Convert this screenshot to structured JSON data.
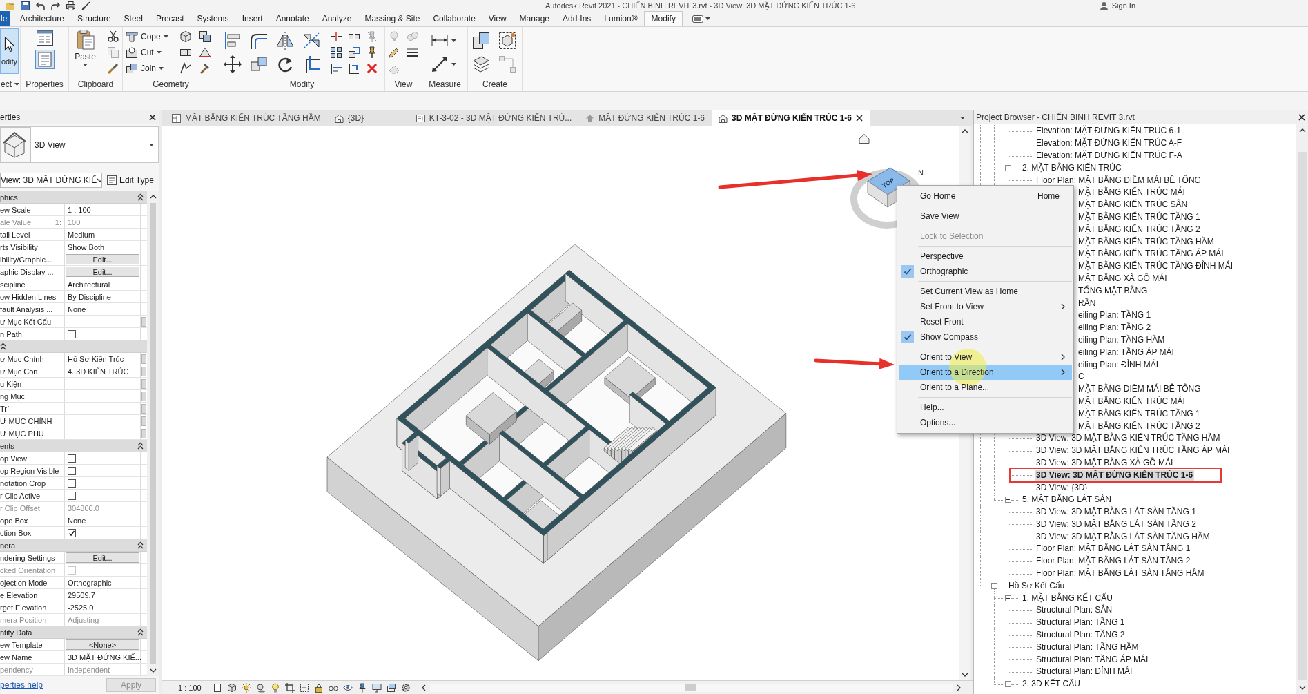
{
  "title_bar": {
    "title": "Autodesk Revit 2021 - CHIẾN BINH REVIT 3.rvt - 3D View: 3D MẶT ĐỨNG KIẾN TRÚC 1-6",
    "sign_in": "Sign In"
  },
  "ribbon": {
    "tabs": [
      {
        "label": "le",
        "kind": "app",
        "selected": false
      },
      {
        "label": "Architecture",
        "kind": "tab",
        "selected": false
      },
      {
        "label": "Structure",
        "kind": "tab",
        "selected": false
      },
      {
        "label": "Steel",
        "kind": "tab",
        "selected": false
      },
      {
        "label": "Precast",
        "kind": "tab",
        "selected": false
      },
      {
        "label": "Systems",
        "kind": "tab",
        "selected": false
      },
      {
        "label": "Insert",
        "kind": "tab",
        "selected": false
      },
      {
        "label": "Annotate",
        "kind": "tab",
        "selected": false
      },
      {
        "label": "Analyze",
        "kind": "tab",
        "selected": false
      },
      {
        "label": "Massing & Site",
        "kind": "tab",
        "selected": false
      },
      {
        "label": "Collaborate",
        "kind": "tab",
        "selected": false
      },
      {
        "label": "View",
        "kind": "tab",
        "selected": false
      },
      {
        "label": "Manage",
        "kind": "tab",
        "selected": false
      },
      {
        "label": "Add-Ins",
        "kind": "tab",
        "selected": false
      },
      {
        "label": "Lumion®",
        "kind": "tab",
        "selected": false
      },
      {
        "label": "Modify",
        "kind": "tab",
        "selected": true
      }
    ],
    "panels": [
      {
        "kind": "select",
        "label": "ect",
        "tools": [
          {
            "label": "odify",
            "selected": true
          }
        ]
      },
      {
        "kind": "properties",
        "label": "Properties"
      },
      {
        "kind": "clipboard",
        "label": "Clipboard",
        "tools": [
          {
            "label": "Paste"
          }
        ]
      },
      {
        "kind": "geometry",
        "label": "Geometry",
        "tools": [
          {
            "label": "Cope"
          },
          {
            "label": "Cut"
          },
          {
            "label": "Join"
          }
        ]
      },
      {
        "kind": "modify",
        "label": "Modify"
      },
      {
        "kind": "view",
        "label": "View"
      },
      {
        "kind": "measure",
        "label": "Measure"
      },
      {
        "kind": "create",
        "label": "Create"
      }
    ]
  },
  "properties": {
    "title": "erties",
    "type_name": "3D View",
    "view_selector": "View: 3D MẶT ĐỨNG KIẾ",
    "edit_type": "Edit Type",
    "groups": [
      {
        "label": "phics",
        "rows": [
          {
            "label": "ew Scale",
            "value": "1 : 100",
            "kind": "text",
            "disabled": false,
            "side_button": false
          },
          {
            "label": "ale Value",
            "unit": "1:",
            "value": "100",
            "kind": "text",
            "disabled": true,
            "side_button": false
          },
          {
            "label": "tail Level",
            "value": "Medium",
            "kind": "text",
            "disabled": false,
            "side_button": false
          },
          {
            "label": "rts Visibility",
            "value": "Show Both",
            "kind": "text",
            "disabled": false,
            "side_button": false
          },
          {
            "label": "ibility/Graphic...",
            "value": "Edit...",
            "kind": "button",
            "disabled": false,
            "side_button": false
          },
          {
            "label": "aphic Display ...",
            "value": "Edit...",
            "kind": "button",
            "disabled": false,
            "side_button": false
          },
          {
            "label": "scipline",
            "value": "Architectural",
            "kind": "text",
            "disabled": false,
            "side_button": false
          },
          {
            "label": "ow Hidden Lines",
            "value": "By Discipline",
            "kind": "text",
            "disabled": false,
            "side_button": false
          },
          {
            "label": "fault Analysis ...",
            "value": "None",
            "kind": "text",
            "disabled": false,
            "side_button": false
          },
          {
            "label": "ư Mục Kết Cấu",
            "kind": "text",
            "disabled": false,
            "side_button": true
          },
          {
            "label": "n Path",
            "kind": "checkbox",
            "checked": false,
            "disabled": false,
            "side_button": false
          }
        ]
      },
      {
        "rows": [
          {
            "label": "ư Mục Chính",
            "value": "Hồ Sơ Kiến Trúc",
            "kind": "text",
            "disabled": false,
            "side_button": true
          },
          {
            "label": "ư Mục Con",
            "value": "4. 3D KIẾN TRÚC",
            "kind": "text",
            "disabled": false,
            "side_button": true
          },
          {
            "label": "u Kiện",
            "kind": "text",
            "disabled": false,
            "side_button": true
          },
          {
            "label": "ng Mục",
            "kind": "text",
            "disabled": false,
            "side_button": true
          },
          {
            "label": "Trí",
            "kind": "text",
            "disabled": false,
            "side_button": true
          },
          {
            "label": "Ư MỤC CHÍNH",
            "kind": "text",
            "disabled": false,
            "side_button": true
          },
          {
            "label": "Ư MỤC PHỤ",
            "kind": "text",
            "disabled": false,
            "side_button": true
          }
        ]
      },
      {
        "label": "ents",
        "rows": [
          {
            "label": "op View",
            "kind": "checkbox",
            "checked": false,
            "disabled": false,
            "side_button": false
          },
          {
            "label": "op Region Visible",
            "kind": "checkbox",
            "checked": false,
            "disabled": false,
            "side_button": false
          },
          {
            "label": "notation Crop",
            "kind": "checkbox",
            "checked": false,
            "disabled": false,
            "side_button": false
          },
          {
            "label": "r Clip Active",
            "kind": "checkbox",
            "checked": false,
            "disabled": false,
            "side_button": false
          },
          {
            "label": "r Clip Offset",
            "value": "304800.0",
            "kind": "text",
            "disabled": true,
            "side_button": false
          },
          {
            "label": "ope Box",
            "value": "None",
            "kind": "text",
            "disabled": false,
            "side_button": false
          },
          {
            "label": "ction Box",
            "kind": "checkbox",
            "checked": true,
            "disabled": false,
            "side_button": false
          }
        ]
      },
      {
        "label": "nera",
        "rows": [
          {
            "label": "ndering Settings",
            "value": "Edit...",
            "kind": "button",
            "disabled": false,
            "side_button": false
          },
          {
            "label": "cked Orientation",
            "kind": "checkbox",
            "checked": false,
            "disabled": true,
            "side_button": false
          },
          {
            "label": "ojection Mode",
            "value": "Orthographic",
            "kind": "text",
            "disabled": false,
            "side_button": false
          },
          {
            "label": "e Elevation",
            "value": "29509.7",
            "kind": "text",
            "disabled": false,
            "side_button": false
          },
          {
            "label": "rget Elevation",
            "value": "-2525.0",
            "kind": "text",
            "disabled": false,
            "side_button": false
          },
          {
            "label": "mera Position",
            "value": "Adjusting",
            "kind": "text",
            "disabled": true,
            "side_button": false
          }
        ]
      },
      {
        "label": "ntity Data",
        "rows": [
          {
            "label": "ew Template",
            "value": "<None>",
            "kind": "button",
            "disabled": false,
            "side_button": false
          },
          {
            "label": "ew Name",
            "value": "3D MẶT ĐỨNG KIẾ...",
            "kind": "text",
            "disabled": false,
            "side_button": false
          },
          {
            "label": "pendency",
            "value": "Independent",
            "kind": "text",
            "disabled": true,
            "side_button": false
          }
        ]
      }
    ],
    "help_link": "perties help",
    "apply": {
      "label": "Apply",
      "disabled": true
    }
  },
  "view_tabs": [
    {
      "label": "MẶT BẰNG KIẾN TRÚC TẦNG HẦM",
      "kind": "plan",
      "selected": false
    },
    {
      "label": "{3D}",
      "kind": "model",
      "selected": false
    },
    {
      "label": "KT-3-02 - 3D MẶT ĐỨNG KIẾN TRÚ...",
      "kind": "sheet",
      "selected": false
    },
    {
      "label": "MẶT ĐỨNG KIẾN TRÚC 1-6",
      "kind": "elevation",
      "selected": false
    },
    {
      "label": "3D MẶT ĐỨNG KIẾN TRÚC 1-6",
      "kind": "model",
      "selected": true
    }
  ],
  "viewport": {
    "view_cube": {
      "face": "TOP",
      "north": "N"
    },
    "scale": "1 : 100"
  },
  "context_menu": {
    "items": [
      {
        "kind": "item",
        "label": "Go Home",
        "shortcut": "Home",
        "checked": false,
        "disabled": false,
        "submenu": false,
        "selected": false
      },
      {
        "kind": "separator"
      },
      {
        "kind": "item",
        "label": "Save View",
        "checked": false,
        "disabled": false,
        "submenu": false,
        "selected": false
      },
      {
        "kind": "separator"
      },
      {
        "kind": "item",
        "label": "Lock to Selection",
        "checked": false,
        "disabled": true,
        "submenu": false,
        "selected": false
      },
      {
        "kind": "separator"
      },
      {
        "kind": "item",
        "label": "Perspective",
        "checked": false,
        "disabled": false,
        "submenu": false,
        "selected": false
      },
      {
        "kind": "item",
        "label": "Orthographic",
        "checked": true,
        "disabled": false,
        "submenu": false,
        "selected": false
      },
      {
        "kind": "separator"
      },
      {
        "kind": "item",
        "label": "Set Current View as Home",
        "checked": false,
        "disabled": false,
        "submenu": false,
        "selected": false
      },
      {
        "kind": "item",
        "label": "Set Front to View",
        "checked": false,
        "disabled": false,
        "submenu": true,
        "selected": false
      },
      {
        "kind": "item",
        "label": "Reset Front",
        "checked": false,
        "disabled": false,
        "submenu": false,
        "selected": false
      },
      {
        "kind": "item",
        "label": "Show Compass",
        "checked": true,
        "disabled": false,
        "submenu": false,
        "selected": false
      },
      {
        "kind": "separator"
      },
      {
        "kind": "item",
        "label": "Orient to View",
        "checked": false,
        "disabled": false,
        "submenu": true,
        "selected": false
      },
      {
        "kind": "item",
        "label": "Orient to a Direction",
        "checked": false,
        "disabled": false,
        "submenu": true,
        "selected": true
      },
      {
        "kind": "item",
        "label": "Orient to a Plane...",
        "checked": false,
        "disabled": false,
        "submenu": false,
        "selected": false
      },
      {
        "kind": "separator"
      },
      {
        "kind": "item",
        "label": "Help...",
        "checked": false,
        "disabled": false,
        "submenu": false,
        "selected": false
      },
      {
        "kind": "item",
        "label": "Options...",
        "checked": false,
        "disabled": false,
        "submenu": false,
        "selected": false
      }
    ]
  },
  "project_browser": {
    "title": "Project Browser - CHIẾN BINH REVIT 3.rvt",
    "tree": [
      {
        "children": [
          {
            "children": [
              {
                "children": [
                  {
                    "label": "Elevation: MẶT ĐỨNG KIẾN TRÚC 6-1",
                    "selected": false
                  },
                  {
                    "label": "Elevation: MẶT ĐỨNG KIẾN TRÚC A-F",
                    "selected": false
                  },
                  {
                    "label": "Elevation: MẶT ĐỨNG KIẾN TRÚC F-A",
                    "selected": false
                  }
                ]
              },
              {
                "label": "2. MẶT BẰNG KIẾN TRÚC",
                "expanded": true,
                "selected": false,
                "children": [
                  {
                    "label": "Floor Plan: MẶT BẰNG DIỀM MÁI BÊ TÔNG",
                    "selected": false
                  },
                  {
                    "label": "MẶT BẰNG KIẾN TRÚC MÁI",
                    "selected": false
                  },
                  {
                    "label": "MẶT BẰNG KIẾN TRÚC SÂN",
                    "selected": false
                  },
                  {
                    "label": "MẶT BẰNG KIẾN TRÚC TẦNG 1",
                    "selected": false
                  },
                  {
                    "label": "MẶT BẰNG KIẾN TRÚC TẦNG 2",
                    "selected": false
                  },
                  {
                    "label": "MẶT BẰNG KIẾN TRÚC TẦNG HẦM",
                    "selected": false
                  },
                  {
                    "label": "MẶT BẰNG KIẾN TRÚC TẦNG ÁP MÁI",
                    "selected": false
                  },
                  {
                    "label": "MẶT BẰNG KIẾN TRÚC TẦNG ĐỈNH MÁI",
                    "selected": false
                  },
                  {
                    "label": "MẶT BẰNG XÀ GỒ MÁI",
                    "selected": false
                  },
                  {
                    "label": "TỔNG MẶT BẰNG",
                    "selected": false
                  }
                ]
              },
              {
                "label": "RẦN",
                "selected": false,
                "children": [
                  {
                    "label": "eiling Plan: TẦNG 1",
                    "selected": false
                  },
                  {
                    "label": "eiling Plan: TẦNG 2",
                    "selected": false
                  },
                  {
                    "label": "eiling Plan: TẦNG HẦM",
                    "selected": false
                  },
                  {
                    "label": "eiling Plan: TẦNG ÁP MÁI",
                    "selected": false
                  },
                  {
                    "label": "eiling Plan: ĐỈNH MÁI",
                    "selected": false
                  }
                ]
              },
              {
                "label": "C",
                "selected": false,
                "children": [
                  {
                    "label": "MẶT BẰNG DIỀM MÁI BÊ TÔNG",
                    "selected": false
                  },
                  {
                    "label": "MẶT BẰNG KIẾN TRÚC MÁI",
                    "selected": false
                  },
                  {
                    "label": "MẶT BẰNG KIẾN TRÚC TẦNG 1",
                    "selected": false
                  },
                  {
                    "label": "MẶT BẰNG KIẾN TRÚC TẦNG 2",
                    "selected": false
                  },
                  {
                    "label": "3D View: 3D MẶT BẰNG KIẾN TRÚC TẦNG HẦM",
                    "selected": false
                  },
                  {
                    "label": "3D View: 3D MẶT BẰNG KIẾN TRÚC TẦNG ÁP MÁI",
                    "selected": false
                  },
                  {
                    "label": "3D View: 3D MẶT BẰNG XÀ GỒ MÁI",
                    "selected": false
                  },
                  {
                    "label": "3D View: 3D MẶT ĐỨNG KIẾN TRÚC 1-6",
                    "selected": true
                  },
                  {
                    "label": "3D View: {3D}",
                    "selected": false
                  }
                ]
              },
              {
                "label": "5. MẶT BẰNG LÁT SÀN",
                "expanded": true,
                "selected": false,
                "children": [
                  {
                    "label": "3D View: 3D MẶT BẰNG LÁT SÀN TẦNG 1",
                    "selected": false
                  },
                  {
                    "label": "3D View: 3D MẶT BẰNG LÁT SÀN TẦNG 2",
                    "selected": false
                  },
                  {
                    "label": "3D View: 3D MẶT BẰNG LÁT SÀN TẦNG HẦM",
                    "selected": false
                  },
                  {
                    "label": "Floor Plan: MẶT BẰNG LÁT SÀN TẦNG 1",
                    "selected": false
                  },
                  {
                    "label": "Floor Plan: MẶT BẰNG LÁT SÀN TẦNG 2",
                    "selected": false
                  },
                  {
                    "label": "Floor Plan: MẶT BẰNG LÁT SÀN TẦNG HẦM",
                    "selected": false
                  }
                ]
              }
            ]
          },
          {
            "label": "Hồ Sơ Kết Cấu",
            "expanded": true,
            "selected": false,
            "children": [
              {
                "label": "1. MẶT BẰNG KẾT CẤU",
                "expanded": true,
                "selected": false,
                "children": [
                  {
                    "label": "Structural Plan: SÂN",
                    "selected": false
                  },
                  {
                    "label": "Structural Plan: TẦNG 1",
                    "selected": false
                  },
                  {
                    "label": "Structural Plan: TẦNG 2",
                    "selected": false
                  },
                  {
                    "label": "Structural Plan: TẦNG HẦM",
                    "selected": false
                  },
                  {
                    "label": "Structural Plan: TẦNG ÁP MÁI",
                    "selected": false
                  },
                  {
                    "label": "Structural Plan: ĐỈNH MÁI",
                    "selected": false
                  }
                ]
              },
              {
                "label": "2. 3D KẾT CẤU",
                "expanded": true,
                "selected": false
              }
            ]
          }
        ]
      }
    ]
  }
}
